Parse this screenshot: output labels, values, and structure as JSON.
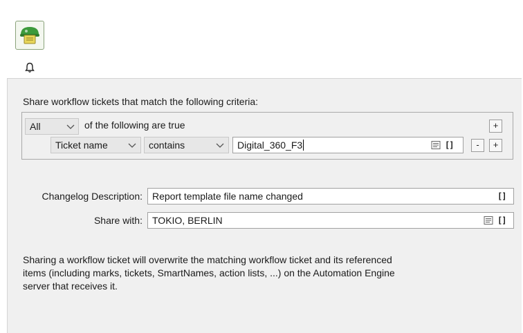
{
  "header": {
    "app_icon": "workflow-ticket-share-icon",
    "bell_icon": "bell-icon"
  },
  "criteria": {
    "intro": "Share workflow tickets that match the following criteria:",
    "match_mode": "All",
    "match_suffix": "of the following are true",
    "rule": {
      "field": "Ticket name",
      "operator": "contains",
      "value": "Digital_360_F3"
    },
    "add_group_label": "+",
    "remove_rule_label": "-",
    "add_rule_label": "+",
    "brackets_label": "[]"
  },
  "changelog": {
    "label": "Changelog Description:",
    "value": "Report template file name changed",
    "brackets_label": "[]"
  },
  "share_with": {
    "label": "Share with:",
    "value": "TOKIO, BERLIN",
    "brackets_label": "[]"
  },
  "note": {
    "line1": "Sharing a workflow ticket will overwrite the matching workflow ticket and its referenced",
    "line2": "items (including marks, tickets, SmartNames, action lists, ...) on the Automation Engine",
    "line3": "server that receives it."
  },
  "colors": {
    "panel_bg": "#f0f0f0",
    "icon_green": "#3c9a3c",
    "icon_yellow": "#e8d65a"
  }
}
